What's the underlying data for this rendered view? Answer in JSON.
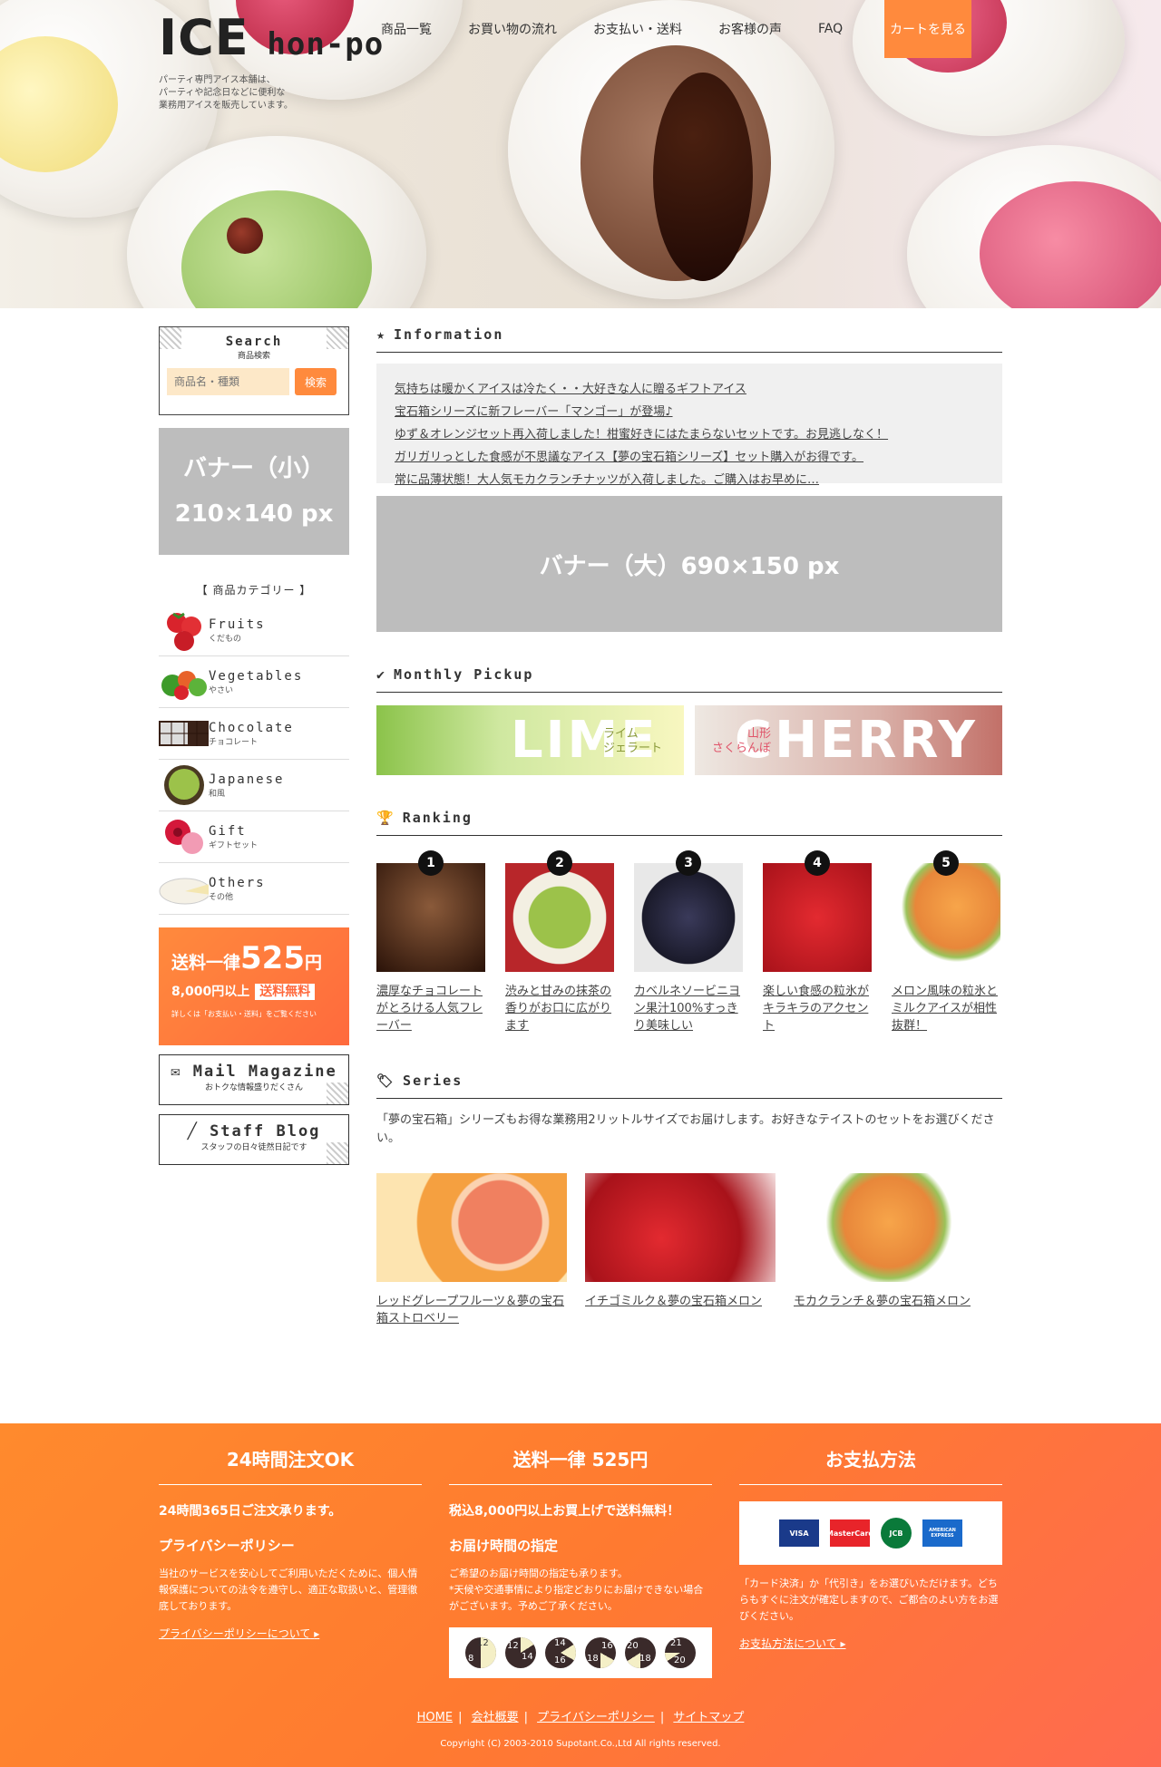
{
  "header": {
    "logo_main": "ICE",
    "logo_sub": "hon-po",
    "tagline": "パーティ専門アイス本舗は、\nパーティや記念日などに便利な\n業務用アイスを販売しています。",
    "nav": [
      "商品一覧",
      "お買い物の流れ",
      "お支払い・送料",
      "お客様の声",
      "FAQ"
    ],
    "cart": "カートを見る"
  },
  "search": {
    "title": "Search",
    "sub": "商品検索",
    "placeholder": "商品名・種類",
    "button": "検索"
  },
  "banner_small": {
    "line1": "バナー（小）",
    "line2": "210×140 px"
  },
  "categories": {
    "title": "【 商品カテゴリー 】",
    "items": [
      {
        "en": "Fruits",
        "jp": "くだもの",
        "icon": "strawberry-icon"
      },
      {
        "en": "Vegetables",
        "jp": "やさい",
        "icon": "vegetables-icon"
      },
      {
        "en": "Chocolate",
        "jp": "チョコレート",
        "icon": "chocolate-icon"
      },
      {
        "en": "Japanese",
        "jp": "和風",
        "icon": "matcha-icon"
      },
      {
        "en": "Gift",
        "jp": "ギフトセット",
        "icon": "flower-icon"
      },
      {
        "en": "Others",
        "jp": "その他",
        "icon": "cheese-icon"
      }
    ]
  },
  "shipping_banner": {
    "prefix": "送料一律",
    "price": "525",
    "unit": "円",
    "cond": "8,000円以上",
    "free": "送料無料",
    "note": "詳しくは「お支払い・送料」をご覧ください"
  },
  "mail": {
    "title": "Mail Magazine",
    "sub": "おトクな情報盛りだくさん"
  },
  "blog": {
    "title": "Staff Blog",
    "sub": "スタッフの日々徒然日記です"
  },
  "information": {
    "heading": "Information",
    "items": [
      "気持ちは暖かくアイスは冷たく・・大好きな人に贈るギフトアイス",
      "宝石箱シリーズに新フレーバー「マンゴー」が登場♪",
      "ゆず＆オレンジセット再入荷しました！柑蜜好きにはたまらないセットです。お見逃しなく！",
      "ガリガリっとした食感が不思議なアイス【夢の宝石箱シリーズ】セット購入がお得です。",
      "常に品薄状態！大人気モカクランチナッツが入荷しました。ご購入はお早めに…"
    ]
  },
  "banner_large": "バナー（大）690×150 px",
  "pickup": {
    "heading": "Monthly Pickup",
    "items": [
      {
        "big": "LIME",
        "small": "ライム\nジェラート"
      },
      {
        "big": "CHERRY",
        "small": "山形\nさくらんぼ"
      }
    ]
  },
  "ranking": {
    "heading": "Ranking",
    "items": [
      {
        "num": "1",
        "text": "濃厚なチョコレートがとろける人気フレーバー"
      },
      {
        "num": "2",
        "text": "渋みと甘みの抹茶の香りがお口に広がります"
      },
      {
        "num": "3",
        "text": "カベルネソービニヨン果汁100%すっきり美味しい"
      },
      {
        "num": "4",
        "text": "楽しい食感の粒氷がキラキラのアクセント"
      },
      {
        "num": "5",
        "text": "メロン風味の粒氷とミルクアイスが相性抜群！"
      }
    ]
  },
  "series": {
    "heading": "Series",
    "text": "「夢の宝石箱」シリーズもお得な業務用2リットルサイズでお届けします。お好きなテイストのセットをお選びください。",
    "items": [
      "レッドグレープフルーツ＆夢の宝石箱ストロベリー",
      "イチゴミルク＆夢の宝石箱メロン",
      "モカクランチ＆夢の宝石箱メロン"
    ]
  },
  "footer": {
    "col1": {
      "title": "24時間注文OK",
      "p1": "24時間365日ご注文承ります。",
      "h": "プライバシーポリシー",
      "p2": "当社のサービスを安心してご利用いただくために、個人情報保護についての法令を遵守し、適正な取扱いと、管理徹底しております。",
      "link": "プライバシーポリシーについて"
    },
    "col2": {
      "title": "送料一律 525円",
      "p1": "税込8,000円以上お買上げで送料無料！",
      "h": "お届け時間の指定",
      "p2": "ご希望のお届け時間の指定も承ります。\n*天候や交通事情により指定どおりにお届けできない場合がございます。予めご了承ください。"
    },
    "col3": {
      "title": "お支払方法",
      "p2": "「カード決済」か「代引き」をお選びいただけます。どちらもすぐに注文が確定しますので、ご都合のよい方をお選びください。",
      "link": "お支払方法について"
    },
    "cards": [
      "VISA",
      "MasterCard",
      "JCB",
      "AMERICAN EXPRESS"
    ],
    "links": [
      "HOME",
      "会社概要",
      "プライバシーポリシー",
      "サイトマップ"
    ],
    "copyright": "Copyright (C) 2003-2010 Supotant.Co.,Ltd All rights reserved."
  }
}
